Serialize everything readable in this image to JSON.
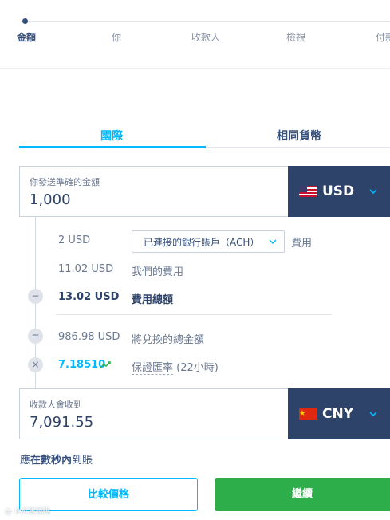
{
  "steps": [
    "金額",
    "你",
    "收款人",
    "檢視",
    "付款"
  ],
  "tabs": {
    "international": "國際",
    "same_currency": "相同貨幣"
  },
  "send": {
    "label": "你發送準確的金額",
    "value": "1,000",
    "currency": "USD"
  },
  "breakdown": {
    "ach_fee_amount": "2 USD",
    "ach_select": "已連接的銀行賬戶（ACH）",
    "ach_fee_label": "費用",
    "our_fee_amount": "11.02 USD",
    "our_fee_label": "我們的費用",
    "total_fee_amount": "13.02 USD",
    "total_fee_label": "費用總額",
    "minus_symbol": "−",
    "equals_symbol": "=",
    "times_symbol": "×",
    "converted_amount": "986.98 USD",
    "converted_label": "將兌換的總金額",
    "rate_value": "7.18510",
    "rate_label": "保證匯率",
    "rate_duration": " (22小時)"
  },
  "receive": {
    "label": "收款人會收到",
    "value": "7,091.55",
    "currency": "CNY"
  },
  "arrival": {
    "prefix": "應",
    "bold": "在數秒內",
    "suffix": "到賬"
  },
  "buttons": {
    "compare": "比較價格",
    "continue": "繼續"
  },
  "watermark": "@ 小紅書號碼",
  "colors": {
    "accent": "#00b9ff",
    "navy": "#2e4369",
    "green": "#2ead4b"
  }
}
